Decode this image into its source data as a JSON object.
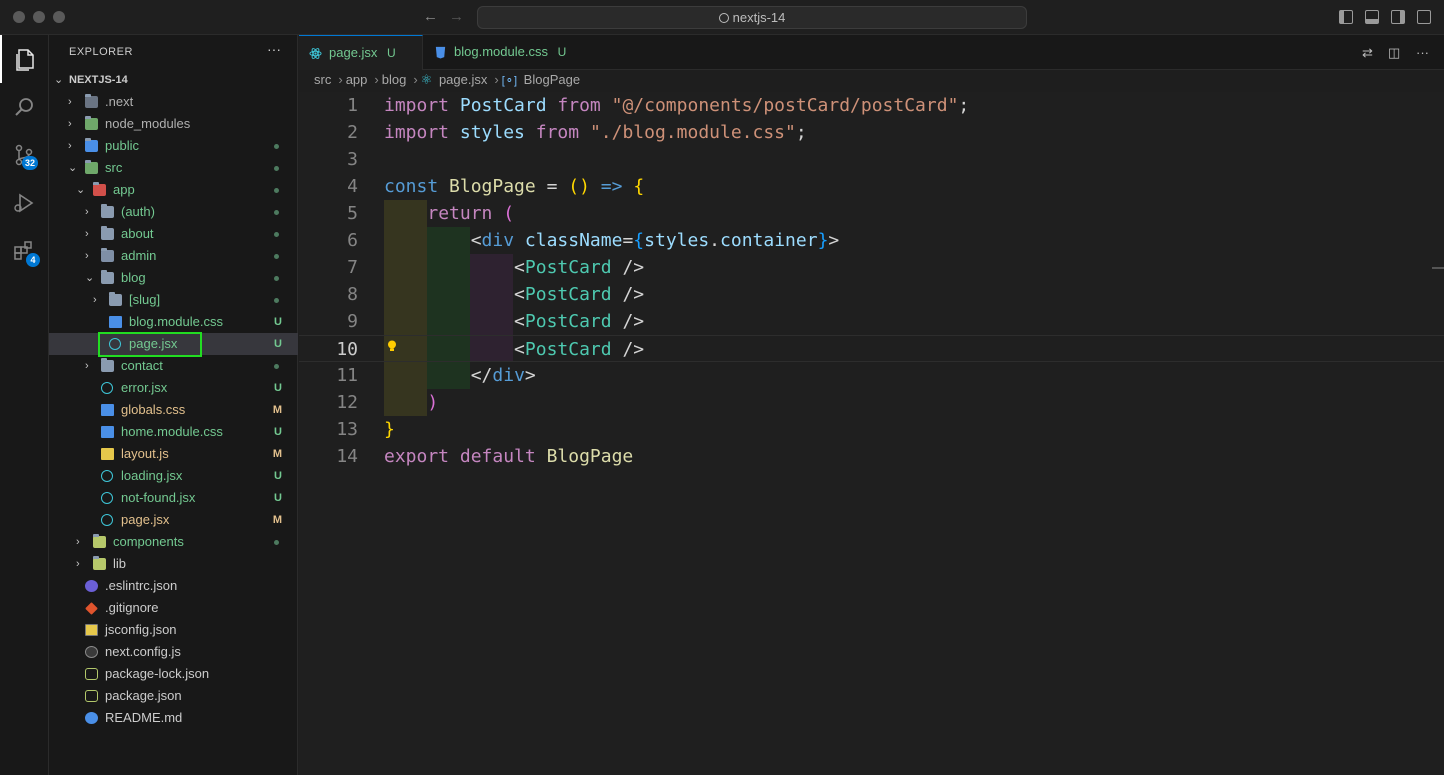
{
  "window": {
    "search_text": "nextjs-14"
  },
  "activity_bar": {
    "source_control_badge": "32",
    "extensions_badge": "4"
  },
  "sidebar": {
    "title": "EXPLORER",
    "more": "···",
    "root": "NEXTJS-14",
    "items": [
      {
        "name": ".next",
        "status": "",
        "dot": false
      },
      {
        "name": "node_modules",
        "status": "",
        "dot": false
      },
      {
        "name": "public",
        "status": "",
        "dot": true
      },
      {
        "name": "src",
        "status": "",
        "dot": true
      },
      {
        "name": "app",
        "status": "",
        "dot": true
      },
      {
        "name": "(auth)",
        "status": "",
        "dot": true
      },
      {
        "name": "about",
        "status": "",
        "dot": true
      },
      {
        "name": "admin",
        "status": "",
        "dot": true
      },
      {
        "name": "blog",
        "status": "",
        "dot": true
      },
      {
        "name": "[slug]",
        "status": "",
        "dot": true
      },
      {
        "name": "blog.module.css",
        "status": "U",
        "dot": false
      },
      {
        "name": "page.jsx",
        "status": "U",
        "dot": false
      },
      {
        "name": "contact",
        "status": "",
        "dot": true
      },
      {
        "name": "error.jsx",
        "status": "U",
        "dot": false
      },
      {
        "name": "globals.css",
        "status": "M",
        "dot": false
      },
      {
        "name": "home.module.css",
        "status": "U",
        "dot": false
      },
      {
        "name": "layout.js",
        "status": "M",
        "dot": false
      },
      {
        "name": "loading.jsx",
        "status": "U",
        "dot": false
      },
      {
        "name": "not-found.jsx",
        "status": "U",
        "dot": false
      },
      {
        "name": "page.jsx",
        "status": "M",
        "dot": false
      },
      {
        "name": "components",
        "status": "",
        "dot": true
      },
      {
        "name": "lib",
        "status": "",
        "dot": false
      },
      {
        "name": ".eslintrc.json",
        "status": "",
        "dot": false
      },
      {
        "name": ".gitignore",
        "status": "",
        "dot": false
      },
      {
        "name": "jsconfig.json",
        "status": "",
        "dot": false
      },
      {
        "name": "next.config.js",
        "status": "",
        "dot": false
      },
      {
        "name": "package-lock.json",
        "status": "",
        "dot": false
      },
      {
        "name": "package.json",
        "status": "",
        "dot": false
      },
      {
        "name": "README.md",
        "status": "",
        "dot": false
      }
    ]
  },
  "tabs": [
    {
      "label": "page.jsx",
      "status": "U"
    },
    {
      "label": "blog.module.css",
      "status": "U"
    }
  ],
  "breadcrumb": [
    "src",
    "app",
    "blog",
    "page.jsx",
    "BlogPage"
  ],
  "editor": {
    "line_numbers": [
      "1",
      "2",
      "3",
      "4",
      "5",
      "6",
      "7",
      "8",
      "9",
      "10",
      "11",
      "12",
      "13",
      "14"
    ],
    "current_line": "10"
  },
  "colors": {
    "accent": "#0078d4",
    "highlight_box": "#22dd22",
    "untracked": "#73c991",
    "modified": "#e2c08d"
  }
}
